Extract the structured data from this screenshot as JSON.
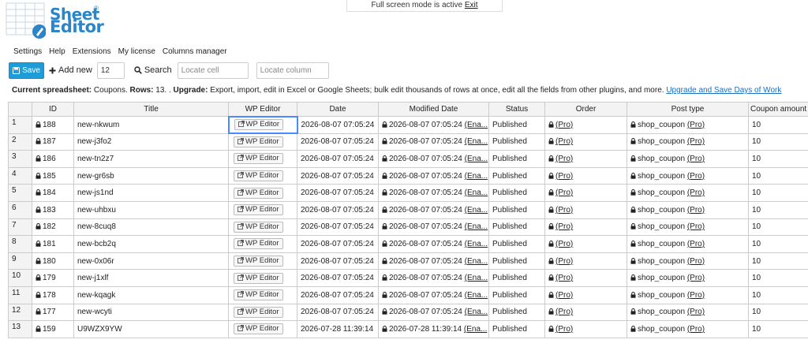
{
  "logo": {
    "line1": "Sheet",
    "line2": "Editor",
    "reg": "®"
  },
  "fullscreen_notice": {
    "text": "Full screen mode is active",
    "exit_label": "Exit"
  },
  "menu": [
    "Settings",
    "Help",
    "Extensions",
    "My license",
    "Columns manager"
  ],
  "toolbar": {
    "save_label": "Save",
    "add_new_label": "Add new",
    "add_new_count": "12",
    "search_label": "Search",
    "locate_cell_placeholder": "Locate cell",
    "locate_column_placeholder": "Locate column"
  },
  "info": {
    "current_label": "Current spreadsheet:",
    "current_value": "Coupons.",
    "rows_label": "Rows:",
    "rows_value": "13. .",
    "upgrade_label": "Upgrade:",
    "upgrade_text": "Export, import, edit in Excel or Google Sheets; bulk edit thousands of rows at once, edit all the fields from other plugins, and more.",
    "upgrade_link": "Upgrade and Save Days of Work"
  },
  "columns": [
    "ID",
    "Title",
    "WP Editor",
    "Date",
    "Modified Date",
    "Status",
    "Order",
    "Post type",
    "Coupon amount"
  ],
  "rows": [
    {
      "n": "1",
      "id": "188",
      "title": "new-nkwum",
      "wp": "WP Editor",
      "date": "2026-08-07 07:05:24",
      "modified": "2026-08-07 07:05:24",
      "ena": "(Ena...",
      "status": "Published",
      "order": "(Pro)",
      "post_type": "shop_coupon",
      "post_type_pro": "(Pro)",
      "amount": "10"
    },
    {
      "n": "2",
      "id": "187",
      "title": "new-j3fo2",
      "wp": "WP Editor",
      "date": "2026-08-07 07:05:24",
      "modified": "2026-08-07 07:05:24",
      "ena": "(Ena...",
      "status": "Published",
      "order": "(Pro)",
      "post_type": "shop_coupon",
      "post_type_pro": "(Pro)",
      "amount": "10"
    },
    {
      "n": "3",
      "id": "186",
      "title": "new-tn2z7",
      "wp": "WP Editor",
      "date": "2026-08-07 07:05:24",
      "modified": "2026-08-07 07:05:24",
      "ena": "(Ena...",
      "status": "Published",
      "order": "(Pro)",
      "post_type": "shop_coupon",
      "post_type_pro": "(Pro)",
      "amount": "10"
    },
    {
      "n": "4",
      "id": "185",
      "title": "new-gr6sb",
      "wp": "WP Editor",
      "date": "2026-08-07 07:05:24",
      "modified": "2026-08-07 07:05:24",
      "ena": "(Ena...",
      "status": "Published",
      "order": "(Pro)",
      "post_type": "shop_coupon",
      "post_type_pro": "(Pro)",
      "amount": "10"
    },
    {
      "n": "5",
      "id": "184",
      "title": "new-js1nd",
      "wp": "WP Editor",
      "date": "2026-08-07 07:05:24",
      "modified": "2026-08-07 07:05:24",
      "ena": "(Ena...",
      "status": "Published",
      "order": "(Pro)",
      "post_type": "shop_coupon",
      "post_type_pro": "(Pro)",
      "amount": "10"
    },
    {
      "n": "6",
      "id": "183",
      "title": "new-uhbxu",
      "wp": "WP Editor",
      "date": "2026-08-07 07:05:24",
      "modified": "2026-08-07 07:05:24",
      "ena": "(Ena...",
      "status": "Published",
      "order": "(Pro)",
      "post_type": "shop_coupon",
      "post_type_pro": "(Pro)",
      "amount": "10"
    },
    {
      "n": "7",
      "id": "182",
      "title": "new-8cuq8",
      "wp": "WP Editor",
      "date": "2026-08-07 07:05:24",
      "modified": "2026-08-07 07:05:24",
      "ena": "(Ena...",
      "status": "Published",
      "order": "(Pro)",
      "post_type": "shop_coupon",
      "post_type_pro": "(Pro)",
      "amount": "10"
    },
    {
      "n": "8",
      "id": "181",
      "title": "new-bcb2q",
      "wp": "WP Editor",
      "date": "2026-08-07 07:05:24",
      "modified": "2026-08-07 07:05:24",
      "ena": "(Ena...",
      "status": "Published",
      "order": "(Pro)",
      "post_type": "shop_coupon",
      "post_type_pro": "(Pro)",
      "amount": "10"
    },
    {
      "n": "9",
      "id": "180",
      "title": "new-0x06r",
      "wp": "WP Editor",
      "date": "2026-08-07 07:05:24",
      "modified": "2026-08-07 07:05:24",
      "ena": "(Ena...",
      "status": "Published",
      "order": "(Pro)",
      "post_type": "shop_coupon",
      "post_type_pro": "(Pro)",
      "amount": "10"
    },
    {
      "n": "10",
      "id": "179",
      "title": "new-j1xlf",
      "wp": "WP Editor",
      "date": "2026-08-07 07:05:24",
      "modified": "2026-08-07 07:05:24",
      "ena": "(Ena...",
      "status": "Published",
      "order": "(Pro)",
      "post_type": "shop_coupon",
      "post_type_pro": "(Pro)",
      "amount": "10"
    },
    {
      "n": "11",
      "id": "178",
      "title": "new-kqagk",
      "wp": "WP Editor",
      "date": "2026-08-07 07:05:24",
      "modified": "2026-08-07 07:05:24",
      "ena": "(Ena...",
      "status": "Published",
      "order": "(Pro)",
      "post_type": "shop_coupon",
      "post_type_pro": "(Pro)",
      "amount": "10"
    },
    {
      "n": "12",
      "id": "177",
      "title": "new-wcyti",
      "wp": "WP Editor",
      "date": "2026-08-07 07:05:24",
      "modified": "2026-08-07 07:05:24",
      "ena": "(Ena...",
      "status": "Published",
      "order": "(Pro)",
      "post_type": "shop_coupon",
      "post_type_pro": "(Pro)",
      "amount": "10"
    },
    {
      "n": "13",
      "id": "159",
      "title": "U9WZX9YW",
      "wp": "WP Editor",
      "date": "2026-07-28 11:39:14",
      "modified": "2026-07-28 11:39:14",
      "ena": "(Ena...",
      "status": "Published",
      "order": "(Pro)",
      "post_type": "shop_coupon",
      "post_type_pro": "(Pro)",
      "amount": "10"
    }
  ],
  "colors": {
    "accent": "#1d9cd8",
    "logo": "#2a86c8",
    "selection": "#4b89ff",
    "link": "#1a6fc2"
  }
}
